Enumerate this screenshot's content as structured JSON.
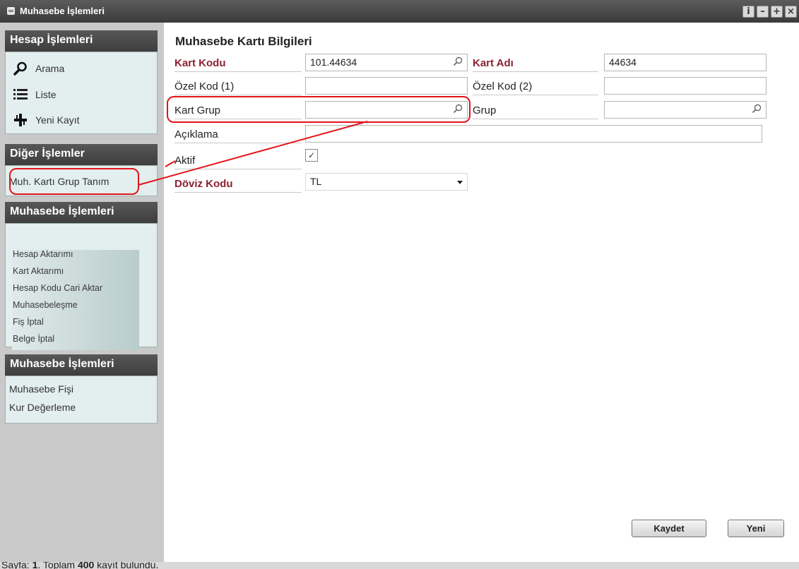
{
  "window": {
    "title": "Muhasebe İşlemleri",
    "buttons": [
      "i",
      "–",
      "+",
      "×"
    ]
  },
  "sidebar": {
    "hesap": {
      "title": "Hesap İşlemleri",
      "items": [
        {
          "label": "Arama",
          "icon": "search-icon"
        },
        {
          "label": "Liste",
          "icon": "list-icon"
        },
        {
          "label": "Yeni Kayıt",
          "icon": "new-record-icon"
        }
      ]
    },
    "diger": {
      "title": "Diğer İşlemler",
      "items": [
        "Muh. Kartı Grup Tanım"
      ]
    },
    "muhasebe1": {
      "title": "Muhasebe İşlemleri",
      "items": [
        "Hesap Aktarımı",
        "Kart Aktarımı",
        "Hesap Kodu Cari Aktar",
        "Muhasebeleşme",
        "Fiş İptal",
        "Belge İptal"
      ]
    },
    "muhasebe2": {
      "title": "Muhasebe İşlemleri",
      "items": [
        "Muhasebe Fişi",
        "Kur Değerleme"
      ]
    }
  },
  "form": {
    "title": "Muhasebe Kartı Bilgileri",
    "kart_kodu": {
      "label": "Kart Kodu",
      "value": "101.44634"
    },
    "kart_adi": {
      "label": "Kart Adı",
      "value": "44634"
    },
    "ozel_kod1": {
      "label": "Özel Kod (1)",
      "value": ""
    },
    "ozel_kod2": {
      "label": "Özel Kod (2)",
      "value": ""
    },
    "kart_grup": {
      "label": "Kart Grup",
      "value": ""
    },
    "grup": {
      "label": "Grup",
      "value": ""
    },
    "aciklama": {
      "label": "Açıklama",
      "value": ""
    },
    "aktif": {
      "label": "Aktif",
      "checked": true,
      "mark": "✓"
    },
    "doviz_kodu": {
      "label": "Döviz Kodu",
      "value": "TL"
    }
  },
  "actions": {
    "save": "Kaydet",
    "new": "Yeni"
  },
  "status": {
    "prefix": "Sayfa: ",
    "page": "1",
    "mid": ". Toplam ",
    "total": "400",
    "suffix": " kayıt bulundu."
  },
  "colors": {
    "required_label": "#8b2232",
    "annotation": "#e3141b",
    "panel_header": "#484848",
    "panel_body": "#e3eeee"
  }
}
